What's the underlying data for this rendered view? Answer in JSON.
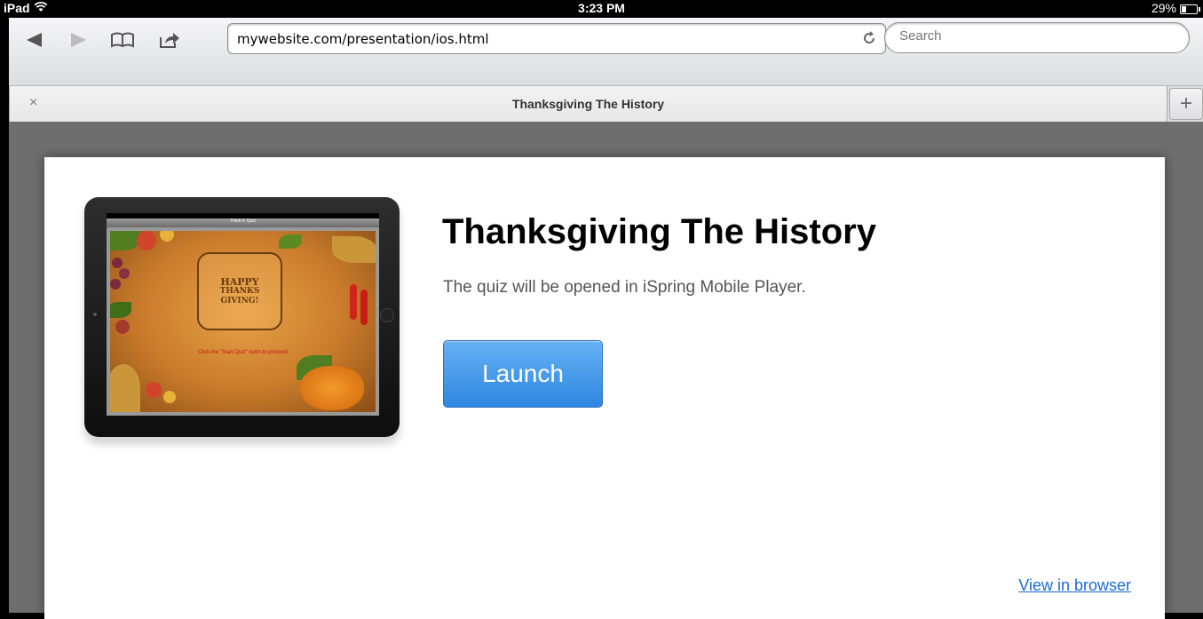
{
  "status_bar": {
    "device": "iPad",
    "time": "3:23 PM",
    "battery": "29%"
  },
  "toolbar": {
    "url": "mywebsite.com/presentation/ios.html",
    "search_placeholder": "Search"
  },
  "tab": {
    "title": "Thanksgiving The History",
    "close_glyph": "×",
    "add_glyph": "+"
  },
  "page": {
    "title": "Thanksgiving The History",
    "subtitle": "The quiz will be opened in iSpring Mobile Player.",
    "launch_label": "Launch",
    "view_in_browser": "View in browser"
  },
  "thumbnail": {
    "header": "Think n' Quiz",
    "badge_lines": [
      "HAPPY",
      "THANKS",
      "GIVING!"
    ],
    "caption": "Click the \"Start Quiz\" buttn to proceed"
  },
  "colors": {
    "accent": "#2f86e0",
    "link": "#1a6ad8",
    "content_bg": "#6e6e6e"
  },
  "icons": [
    "wifi-icon",
    "battery-icon",
    "back-icon",
    "forward-icon",
    "bookmarks-icon",
    "share-icon",
    "reload-icon"
  ]
}
